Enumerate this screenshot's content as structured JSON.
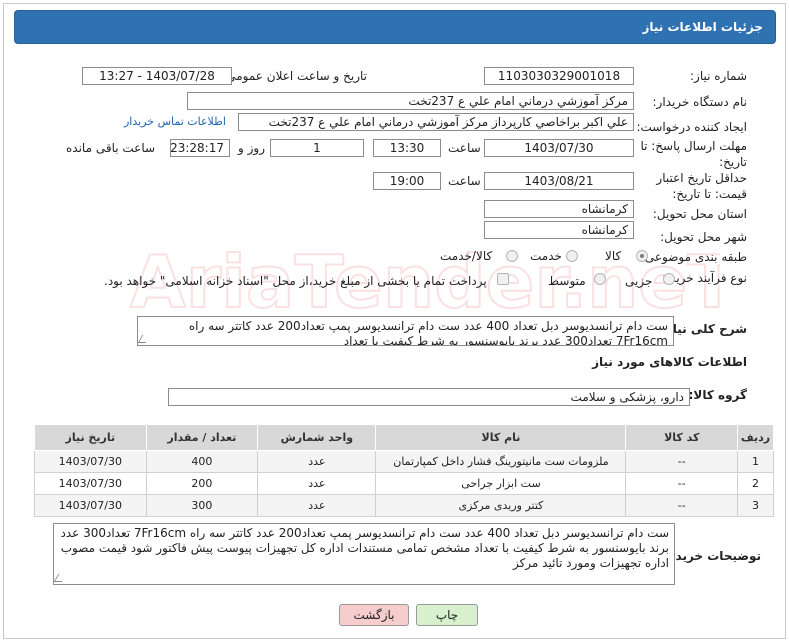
{
  "header": {
    "title": "جزئیات اطلاعات نیاز"
  },
  "fields": {
    "need_number": {
      "label": "شماره نیاز:",
      "value": "1103030329001018"
    },
    "announce_datetime": {
      "label": "تاریخ و ساعت اعلان عمومی:",
      "value": "1403/07/28 - 13:27"
    },
    "buyer_org": {
      "label": "نام دستگاه خریدار:",
      "value": "مرکز آموزشي درماني امام علي ع 237تخت"
    },
    "requester": {
      "label": "ایجاد کننده درخواست:",
      "value": "علي اکبر براخاصي کارپرداز  مرکز آموزشي درماني امام علي ع 237تخت",
      "contact_link": "اطلاعات تماس خریدار"
    },
    "deadline": {
      "label": "مهلت ارسال پاسخ: تا تاریخ:",
      "date": "1403/07/30",
      "time_label": "ساعت",
      "time": "13:30",
      "days": "1",
      "days_label": "روز و",
      "remaining": "23:28:17",
      "remaining_label": "ساعت باقی مانده"
    },
    "price_validity": {
      "label": "حداقل تاریخ اعتبار قیمت: تا تاریخ:",
      "date": "1403/08/21",
      "time_label": "ساعت",
      "time": "19:00"
    },
    "province": {
      "label": "استان محل تحویل:",
      "value": "کرمانشاه"
    },
    "city": {
      "label": "شهر محل تحویل:",
      "value": "کرمانشاه"
    },
    "category": {
      "label": "طبقه بندی موضوعی:",
      "options": [
        "کالا",
        "خدمت",
        "کالا/خدمت"
      ],
      "selected": "کالا"
    },
    "purchase_type": {
      "label": "نوع فرآیند خرید :",
      "options": [
        "جزیی",
        "متوسط"
      ],
      "note": "پرداخت تمام یا بخشی از مبلغ خرید،از محل \"اسناد خزانه اسلامی\" خواهد بود."
    },
    "overall_desc": {
      "label": "شرح کلی نیاز:",
      "value": "ست دام ترانسديوسر  دبل تعداد 400 عدد ست دام ترانسديوسر پمپ تعداد200 عدد کاتتر سه راه 7Fr16cm تعداد300 عدد برند بایوسنسور به شرط کیفیت با تعداد"
    }
  },
  "goods_section": {
    "title": "اطلاعات کالاهای مورد نیاز",
    "group_label": "گروه کالا:",
    "group_value": "دارو، پزشکی و سلامت"
  },
  "table": {
    "columns": [
      "ردیف",
      "کد کالا",
      "نام کالا",
      "واحد شمارش",
      "تعداد / مقدار",
      "تاریخ نیاز"
    ],
    "rows": [
      [
        "1",
        "--",
        "ملزومات ست مانیتورینگ فشار داخل کمپارتمان",
        "عدد",
        "400",
        "1403/07/30"
      ],
      [
        "2",
        "--",
        "ست ابزار جراحی",
        "عدد",
        "200",
        "1403/07/30"
      ],
      [
        "3",
        "--",
        "کتتر وریدی مرکزی",
        "عدد",
        "300",
        "1403/07/30"
      ]
    ]
  },
  "buyer_notes": {
    "label": "توضیحات خریدار:",
    "value": "ست دام ترانسديوسر  دبل تعداد 400 عدد ست دام ترانسديوسر پمپ تعداد200 عدد کاتتر سه راه 7Fr16cm تعداد300 عدد برند بایوسنسور به شرط کیفیت با تعداد مشخص تمامی مستندات اداره کل تجهیزات پیوست پیش فاکتور شود قیمت مصوب اداره تجهیزات ومورد تائید مرکز"
  },
  "buttons": {
    "print": "چاپ",
    "back": "بازگشت"
  },
  "watermark": "AriaTender.neT"
}
